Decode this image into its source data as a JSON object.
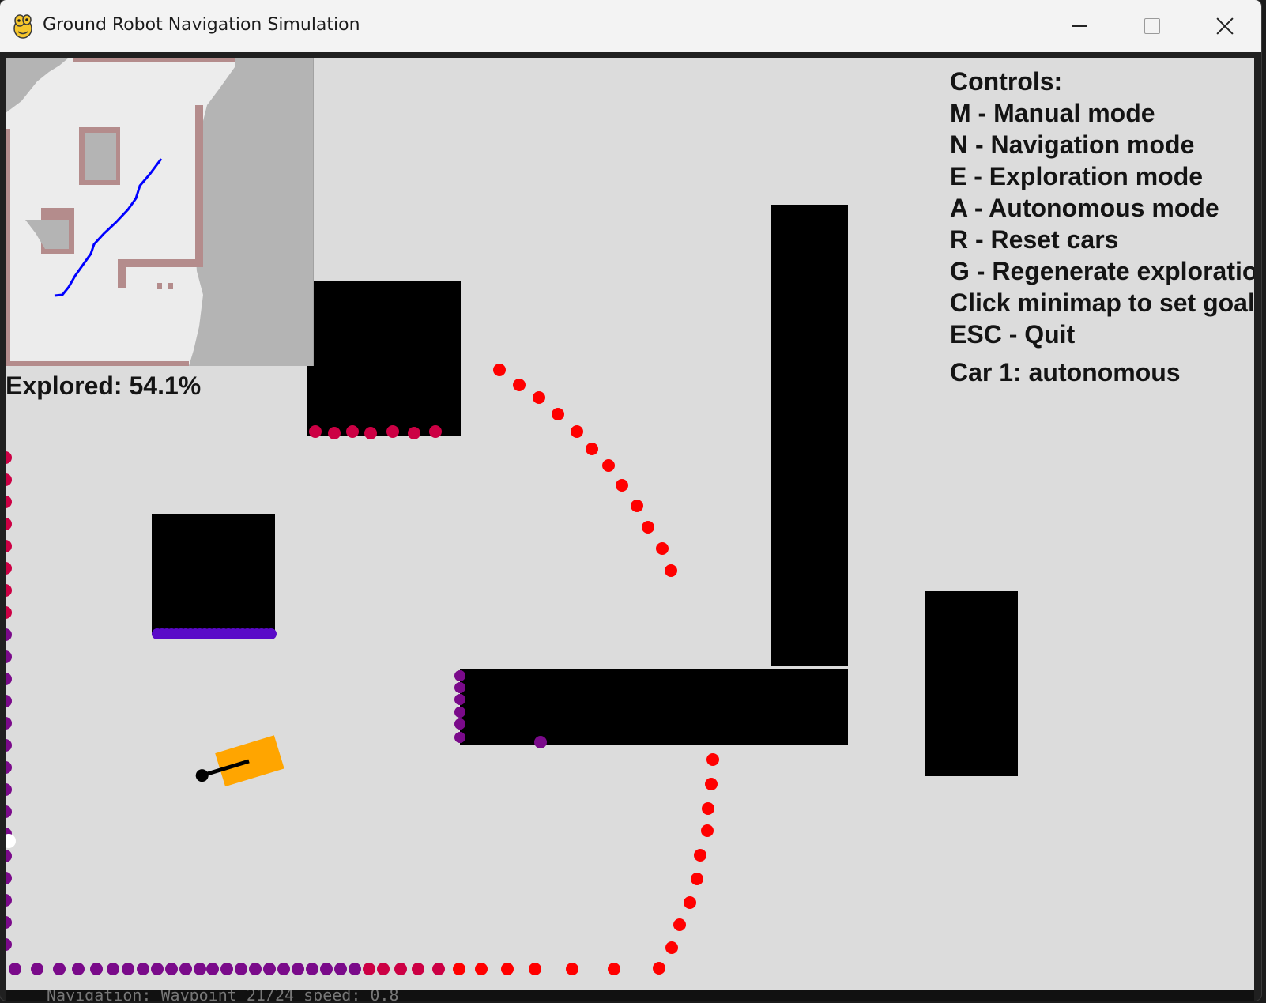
{
  "window": {
    "title": "Ground Robot Navigation Simulation",
    "icon": "pygame-snake-icon",
    "minimize_icon": "minimize-icon",
    "maximize_icon": "maximize-icon",
    "close_icon": "close-icon"
  },
  "hud": {
    "controls_title": "Controls:",
    "controls": [
      "M - Manual mode",
      "N - Navigation mode",
      "E - Exploration mode",
      "A - Autonomous mode",
      "R - Reset cars",
      "G - Regenerate exploratio",
      "Click minimap to set goal",
      "ESC - Quit"
    ],
    "car_status": "Car 1: autonomous",
    "explored": "Explored: 54.1%"
  },
  "status_bar": {
    "text": "Navigation: Waypoint 21/24  speed: 0.8"
  },
  "colors": {
    "background": "#dcdcdc",
    "obstacle": "#000000",
    "lidar_red": "#ff0000",
    "lidar_crimson": "#cc0044",
    "lidar_purple": "#7a0a8a",
    "lidar_indigo": "#5a0ac8",
    "robot_body": "#ffa500",
    "path": "#0000ff",
    "minimap_unknown": "#b4b4b4",
    "minimap_free": "#ececec",
    "minimap_wall": "#b48c8c"
  }
}
